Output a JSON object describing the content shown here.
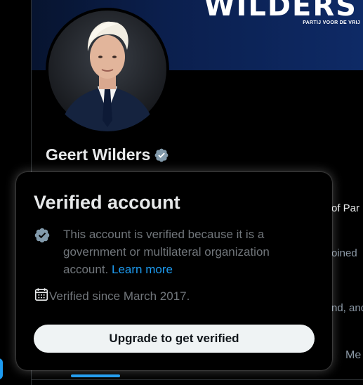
{
  "banner": {
    "logo_text": "WILDERS",
    "sub_text": "PARTIJ VOOR DE VRIJ"
  },
  "profile": {
    "name": "Geert Wilders",
    "badge_icon": "verified-badge-icon",
    "badge_color": "#829aab"
  },
  "background_peek": {
    "line1": "of Par",
    "line2": "oined",
    "line3": "nd, and",
    "tab_partial": "Me"
  },
  "popover": {
    "title": "Verified account",
    "description": "This account is verified because it is a government or multilateral organization account.",
    "learn_more": "Learn more",
    "verified_since": "Verified since March 2017.",
    "calendar_icon": "calendar-icon",
    "upgrade_button": "Upgrade to get verified"
  },
  "colors": {
    "accent": "#1d9bf0",
    "muted_text": "#71767b",
    "badge_gray": "#829aab",
    "button_bg": "#eff3f4"
  }
}
